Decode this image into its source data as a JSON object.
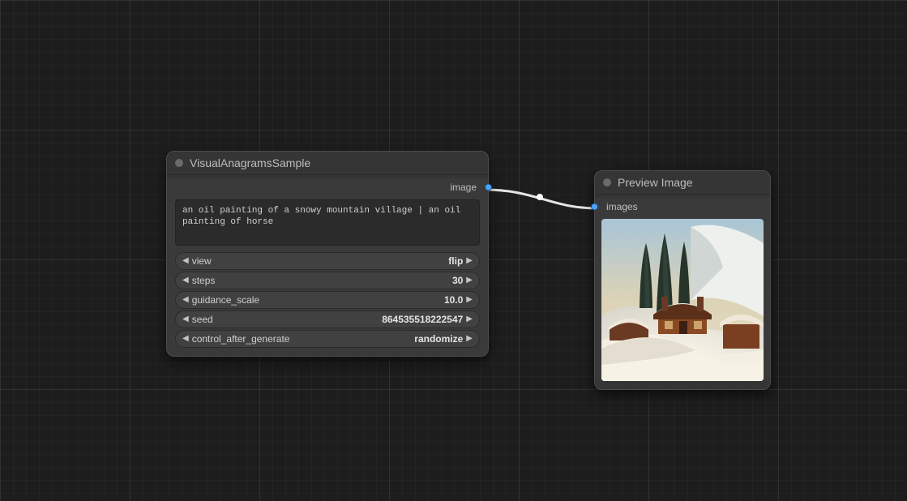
{
  "nodes": {
    "sampler": {
      "title": "VisualAnagramsSample",
      "output_slot": "image",
      "prompt": "an oil painting of a snowy mountain village | an oil painting of horse",
      "widgets": {
        "view": {
          "label": "view",
          "value": "flip"
        },
        "steps": {
          "label": "steps",
          "value": "30"
        },
        "guidance_scale": {
          "label": "guidance_scale",
          "value": "10.0"
        },
        "seed": {
          "label": "seed",
          "value": "864535518222547"
        },
        "control_after_generate": {
          "label": "control_after_generate",
          "value": "randomize"
        }
      }
    },
    "preview": {
      "title": "Preview Image",
      "input_slot": "images"
    }
  },
  "colors": {
    "port": "#4aa3ff"
  }
}
